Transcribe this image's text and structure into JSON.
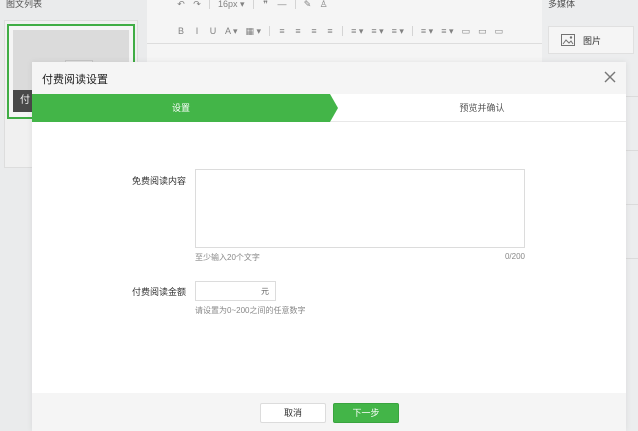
{
  "left_panel": {
    "title": "图文列表",
    "card_label": "付"
  },
  "toolbar": {
    "row1": [
      "↶",
      "↷",
      "16px ▾",
      "❞",
      "—",
      "✎",
      "♙"
    ],
    "row2": [
      "B",
      "I",
      "U",
      "A ▾",
      "▦ ▾",
      "≡",
      "≡",
      "≡",
      "≡",
      "≡ ▾",
      "≡ ▾",
      "≡ ▾",
      "≡ ▾",
      "≡ ▾",
      "▭",
      "▭",
      "▭"
    ]
  },
  "right_panel": {
    "title": "多媒体",
    "media_items": [
      {
        "label": "图片",
        "icon": "image-icon"
      }
    ]
  },
  "modal": {
    "title": "付费阅读设置",
    "close_icon": "close-icon",
    "steps": [
      {
        "label": "设置",
        "active": true
      },
      {
        "label": "预览并确认",
        "active": false
      }
    ],
    "free_content": {
      "label": "免费阅读内容",
      "value": "",
      "hint": "至少输入20个文字",
      "counter": "0/200"
    },
    "amount": {
      "label": "付费阅读金额",
      "value": "",
      "unit": "元",
      "hint": "请设置为0~200之间的任意数字"
    },
    "buttons": {
      "cancel": "取消",
      "next": "下一步"
    }
  },
  "colors": {
    "accent_green": "#43b548",
    "modal_header_bg": "#f5f5f5",
    "border": "#dcdcdc"
  }
}
